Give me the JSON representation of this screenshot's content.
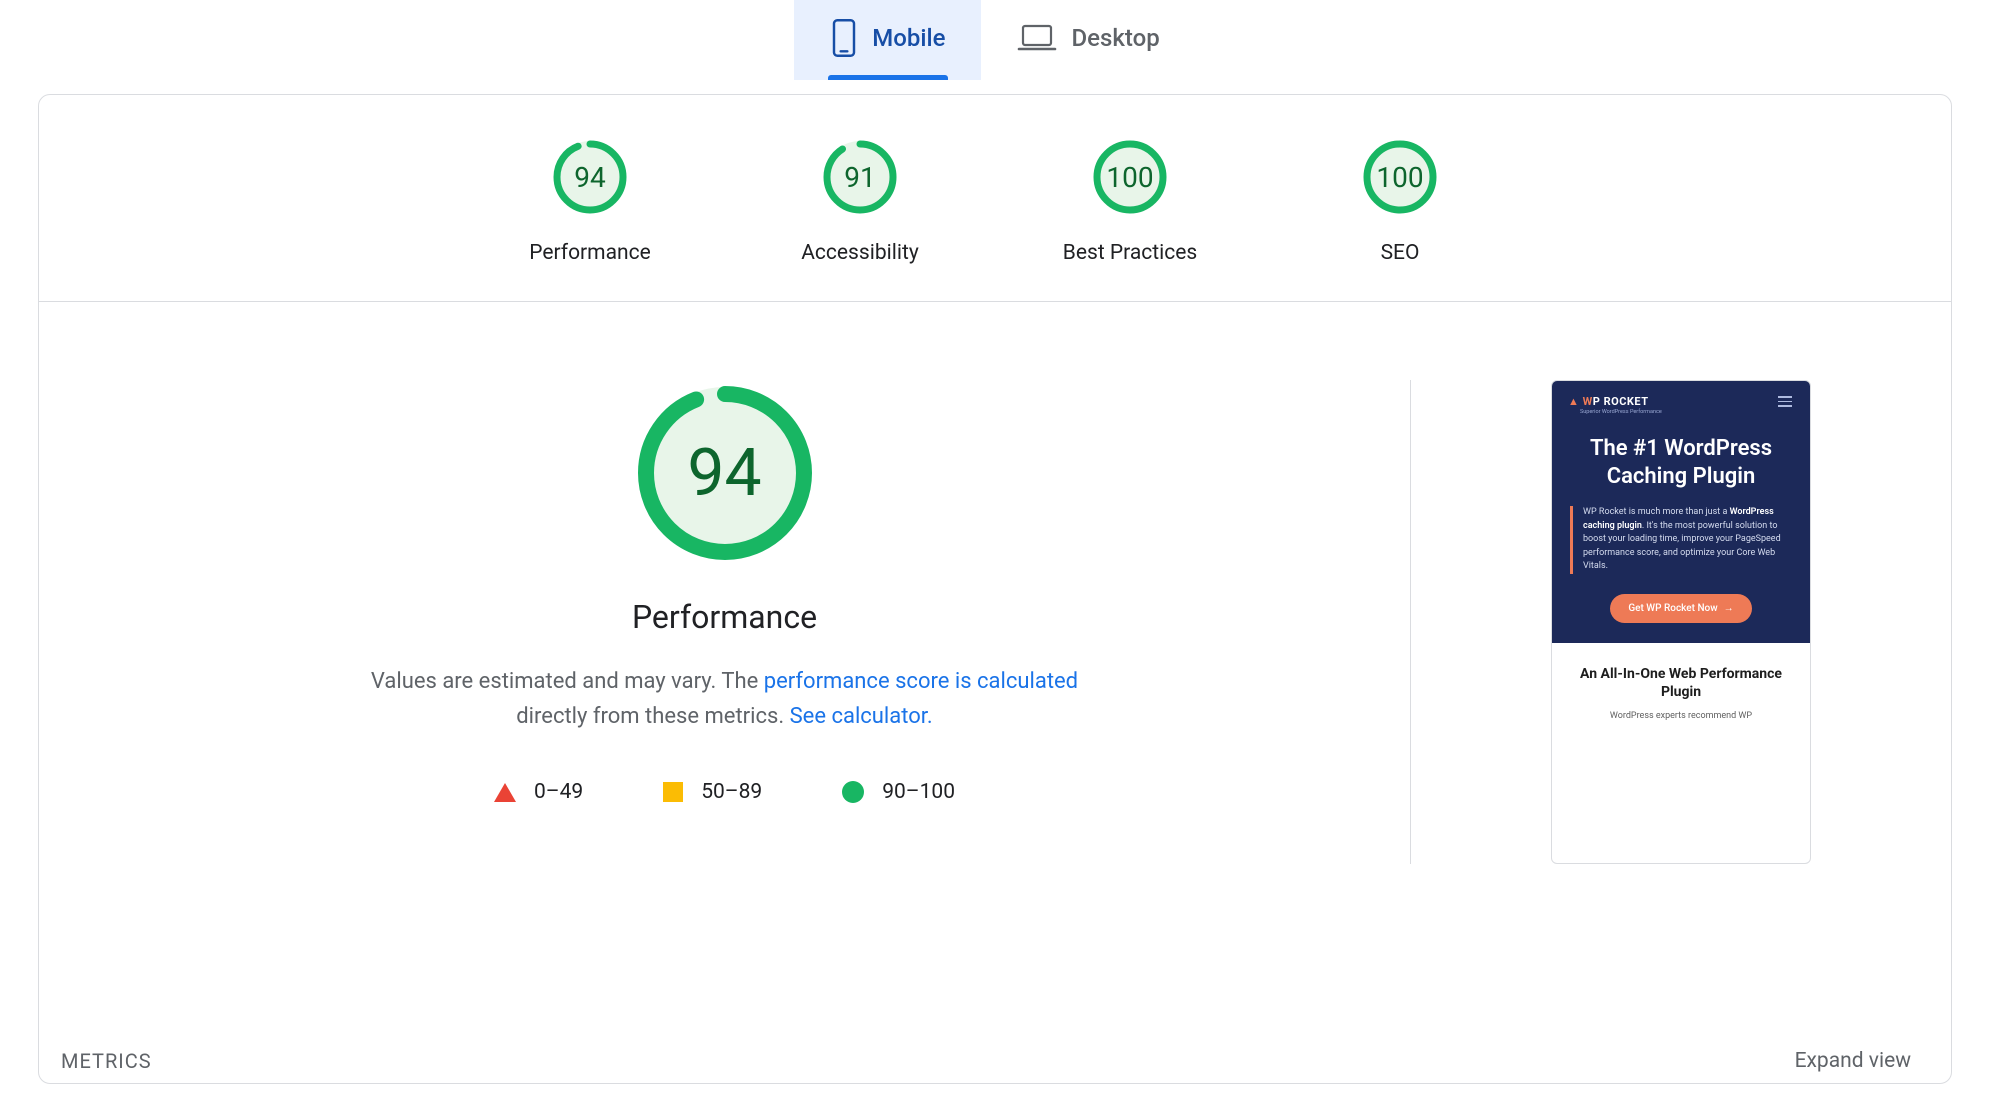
{
  "tabs": {
    "mobile": "Mobile",
    "desktop": "Desktop",
    "active": "mobile"
  },
  "gauges": [
    {
      "label": "Performance",
      "value": 94
    },
    {
      "label": "Accessibility",
      "value": 91
    },
    {
      "label": "Best Practices",
      "value": 100
    },
    {
      "label": "SEO",
      "value": 100
    }
  ],
  "perf": {
    "value": 94,
    "title": "Performance",
    "desc_pre": "Values are estimated and may vary. The ",
    "link1": "performance score is calculated",
    "desc_mid": " directly from these metrics. ",
    "link2": "See calculator."
  },
  "legend": {
    "low": "0–49",
    "mid": "50–89",
    "high": "90–100"
  },
  "preview": {
    "brand_prefix": "W",
    "brand_rest": "P ROCKET",
    "brand_sub": "Superior WordPress Performance",
    "heading": "The #1 WordPress Caching Plugin",
    "body_pre": "WP Rocket is much more than just a ",
    "body_strong": "WordPress caching plugin",
    "body_post": ". It's the most powerful solution to boost your loading time, improve your PageSpeed performance score, and optimize your Core Web Vitals.",
    "cta": "Get WP Rocket Now",
    "sub_heading": "An All-In-One Web Performance Plugin",
    "sub_text": "WordPress experts recommend WP"
  },
  "metrics": {
    "title": "METRICS",
    "expand": "Expand view"
  }
}
